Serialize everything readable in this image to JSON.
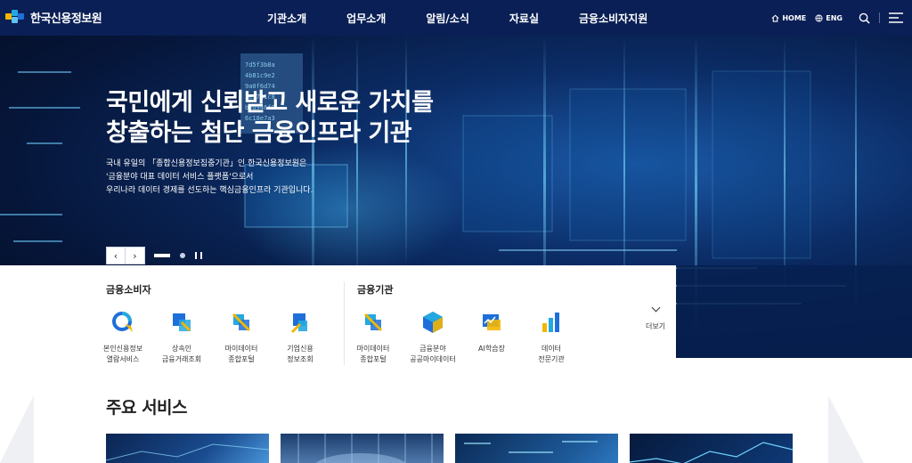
{
  "header": {
    "logo_text": "한국신용정보원",
    "nav": [
      "기관소개",
      "업무소개",
      "알림/소식",
      "자료실",
      "금융소비자지원"
    ],
    "util": {
      "home": "HOME",
      "eng": "ENG"
    }
  },
  "hero": {
    "title_line1": "국민에게 신뢰받고 새로운 가치를",
    "title_line2": "창출하는 첨단 금융인프라 기관",
    "desc_line1": "국내 유일의 「종합신용정보집중기관」인 한국신용정보원은",
    "desc_line2": "'금융분야 대표 데이터 서비스 플랫폼'으로서",
    "desc_line3": "우리나라 데이터 경제를 선도하는 핵심금융인프라 기관입니다.",
    "prev_label": "‹",
    "next_label": "›"
  },
  "quick": {
    "consumer_title": "금융소비자",
    "institution_title": "금융기관",
    "consumer_items": [
      {
        "label": "본인신용정보\n열람서비스",
        "icon": "credit-view-icon"
      },
      {
        "label": "상속인\n금융거래조회",
        "icon": "heir-inquiry-icon"
      },
      {
        "label": "마이데이터\n종합포털",
        "icon": "mydata-icon"
      },
      {
        "label": "기업신용\n정보조회",
        "icon": "corp-credit-icon"
      }
    ],
    "institution_items": [
      {
        "label": "마이데이터\n종합포털",
        "icon": "mydata-icon"
      },
      {
        "label": "금융분야\n공공마이데이터",
        "icon": "public-mydata-icon"
      },
      {
        "label": "AI학습장",
        "icon": "ai-learning-icon"
      },
      {
        "label": "데이터\n전문기관",
        "icon": "data-agency-icon"
      }
    ],
    "more_label": "더보기"
  },
  "main": {
    "title": "주요 서비스"
  },
  "colors": {
    "header_bg": "#0a1f55",
    "accent_blue": "#1e6fd9",
    "accent_yellow": "#f2b705",
    "accent_cyan": "#24a8e0"
  }
}
